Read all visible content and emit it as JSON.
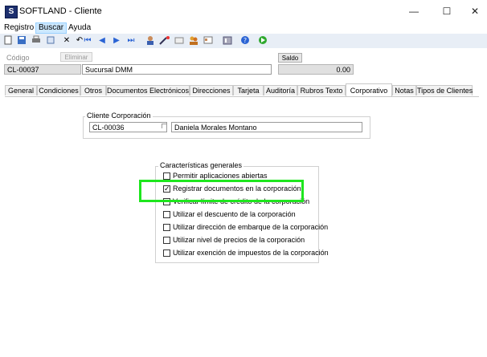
{
  "window": {
    "title": "SOFTLAND - Cliente",
    "icon_letter": "S",
    "minimize": "—",
    "maximize": "☐",
    "close": "✕"
  },
  "menu": [
    {
      "label": "Registro"
    },
    {
      "label": "Buscar"
    },
    {
      "label": "Ayuda"
    }
  ],
  "toolbar_icons": [
    "new-icon",
    "save-icon",
    "print-icon",
    "delete-icon",
    "undo-icon",
    "first-icon",
    "prev-icon",
    "next-icon",
    "last-icon",
    "user-icon",
    "wand-icon",
    "document-icon",
    "users-icon",
    "card-icon",
    "report-icon",
    "help-icon",
    "go-icon"
  ],
  "header": {
    "codigo_label": "Código",
    "codigo_value": "CL-00037",
    "eliminar_label": "Eliminar",
    "nombre_value": "Sucursal DMM",
    "saldo_label": "Saldo",
    "saldo_value": "0.00"
  },
  "tabs": [
    {
      "label": "General"
    },
    {
      "label": "Condiciones"
    },
    {
      "label": "Otros"
    },
    {
      "label": "Documentos Electrónicos"
    },
    {
      "label": "Direcciones"
    },
    {
      "label": "Tarjeta"
    },
    {
      "label": "Auditoría"
    },
    {
      "label": "Rubros Texto"
    },
    {
      "label": "Corporativo"
    },
    {
      "label": "Notas"
    },
    {
      "label": "Tipos de Clientes"
    }
  ],
  "corporativo": {
    "cliente_corp_title": "Cliente Corporación",
    "cliente_corp_code": "CL-00036",
    "cliente_corp_name": "Daniela Morales Montano",
    "caracteristicas_title": "Características generales",
    "options": [
      {
        "label": "Permitir aplicaciones abiertas",
        "checked": false
      },
      {
        "label": "Registrar documentos en la corporación",
        "checked": true
      },
      {
        "label": "Verificar límite de crédito de la corporación",
        "checked": false
      },
      {
        "label": "Utilizar el descuento de la corporación",
        "checked": false
      },
      {
        "label": "Utilizar dirección de embarque de la corporación",
        "checked": false
      },
      {
        "label": "Utilizar nivel de precios de la corporación",
        "checked": false
      },
      {
        "label": "Utilizar exención de impuestos de la corporación",
        "checked": false
      }
    ]
  },
  "colors": {
    "highlight": "#1ee61e",
    "toolbar_bg": "#e8eef6",
    "menu_active": "#cce8ff"
  }
}
